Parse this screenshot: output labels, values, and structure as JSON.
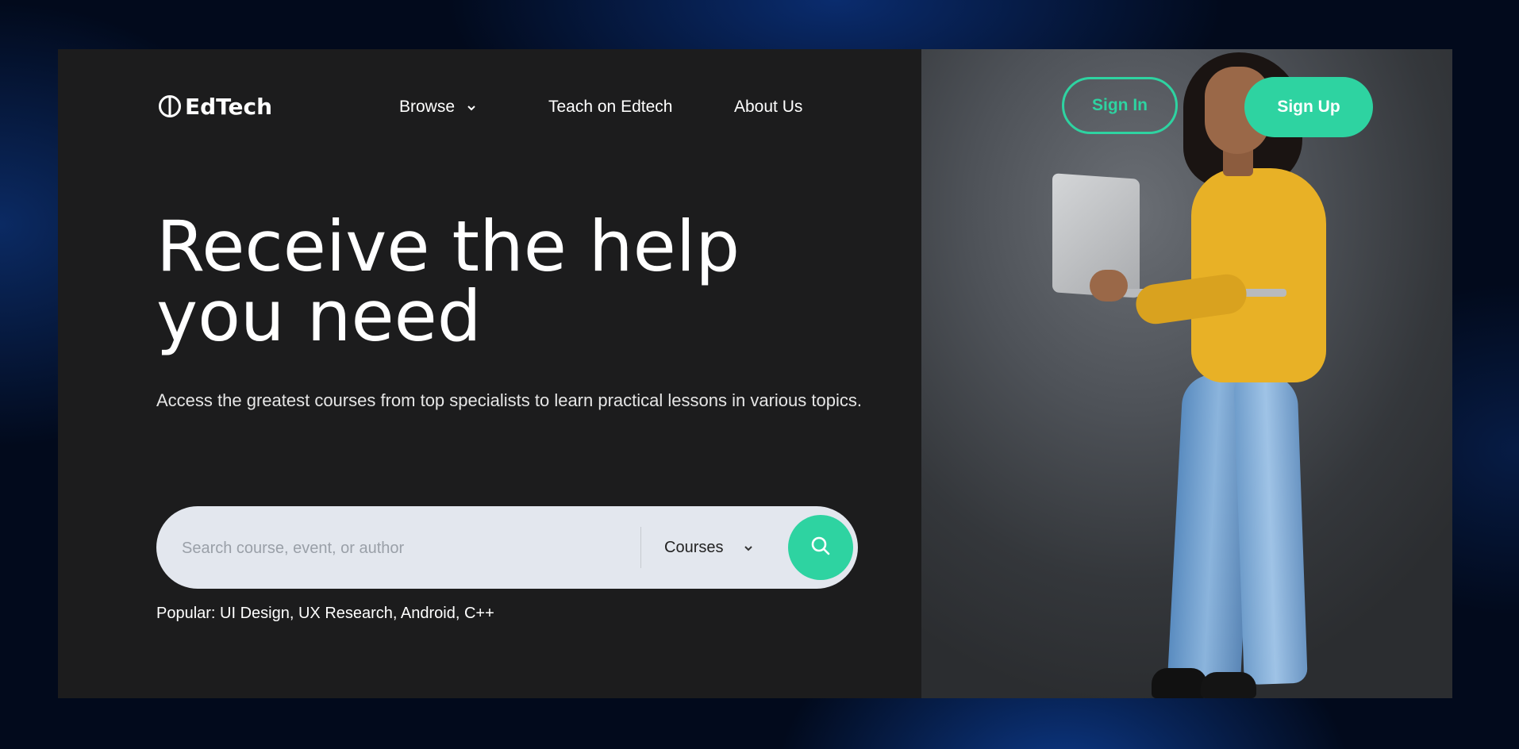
{
  "brand": {
    "name": "EdTech",
    "icon": "circle-divided-icon"
  },
  "nav": {
    "browse": "Browse",
    "teach": "Teach on Edtech",
    "about": "About Us"
  },
  "auth": {
    "sign_in": "Sign In",
    "sign_up": "Sign Up"
  },
  "hero": {
    "headline_line1": "Receive the help",
    "headline_line2": "you need",
    "subtext": "Access the greatest courses from top specialists to learn practical lessons in various topics."
  },
  "search": {
    "placeholder": "Search course, event, or author",
    "value": "",
    "category": "Courses",
    "button_icon": "search-icon"
  },
  "popular": "Popular: UI Design, UX Research, Android, C++",
  "colors": {
    "accent": "#2ed3a1",
    "panel": "#1c1c1d",
    "search_bg": "#e3e7ee"
  }
}
